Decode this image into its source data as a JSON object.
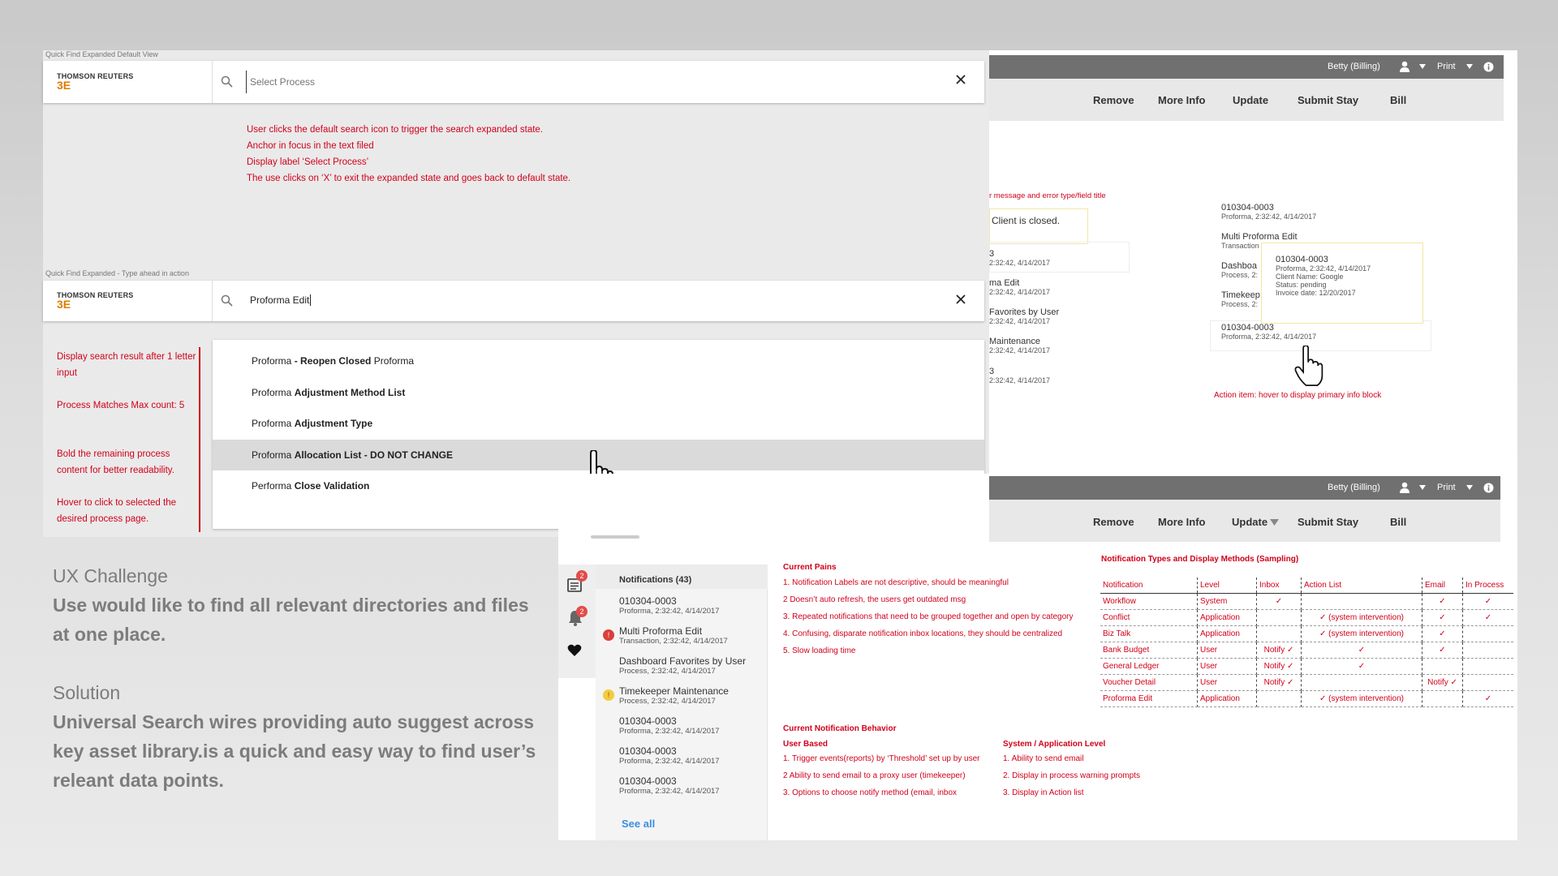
{
  "caption_default": "Quick Find Expanded Default View",
  "caption_typeahead": "Quick Find Expanded - Type ahead in action",
  "logo": {
    "top": "THOMSON REUTERS",
    "mark": "3E"
  },
  "default_search": {
    "placeholder": "Select Process",
    "notes": [
      "User clicks the default search icon to trigger the search expanded state.",
      "Anchor in focus in the text filed",
      "Display label ‘Select Process’",
      "The use clicks on ‘X’ to exit the expanded state and goes back to default state."
    ]
  },
  "typeahead_search": {
    "value": "Proforma Edit",
    "side_notes": [
      "Display search result after 1 letter input",
      "Process Matches Max count: 5",
      "Bold the  remaining process content for better readability.",
      "Hover to click to selected the desired process page."
    ],
    "results": [
      {
        "prefix": "Proforma",
        "bold": " - Reopen Closed",
        "suffix": " Proforma"
      },
      {
        "prefix": "Proforma ",
        "bold": "Adjustment Method List",
        "suffix": ""
      },
      {
        "prefix": "Proforma ",
        "bold": "Adjustment Type",
        "suffix": ""
      },
      {
        "prefix": "Proforma ",
        "bold": "Allocation List - DO NOT CHANGE",
        "suffix": ""
      },
      {
        "prefix": "Performa ",
        "bold": "Close Validation",
        "suffix": ""
      }
    ]
  },
  "topbar": {
    "user": "Betty (Billing)",
    "print": "Print"
  },
  "toolbar": {
    "remove": "Remove",
    "more_info": "More Info",
    "update": "Update",
    "submit_stay": "Submit Stay",
    "bill": "Bill"
  },
  "hover_panel": {
    "error_note": "r message and error type/field title",
    "client_closed": "Client is closed.",
    "left_items": [
      {
        "t": "3",
        "s": "2:32:42, 4/14/2017"
      },
      {
        "t": "ma Edit",
        "s": "2:32:42, 4/14/2017"
      },
      {
        "t": "Favorites by User",
        "s": "2:32:42, 4/14/2017"
      },
      {
        "t": "Maintenance",
        "s": "2:32:42, 4/14/2017"
      },
      {
        "t": "3",
        "s": "2:32:42, 4/14/2017"
      }
    ],
    "right_items": [
      {
        "t": "010304-0003",
        "s": "Proforma, 2:32:42, 4/14/2017"
      },
      {
        "t": "Multi Proforma Edit",
        "s": "Transaction"
      },
      {
        "t": "Dashboa",
        "s": "Process, 2:"
      },
      {
        "t": "Timekeep",
        "s": "Process, 2:"
      },
      {
        "t": "010304-0003",
        "s": "Proforma, 2:32:42, 4/14/2017"
      }
    ],
    "tooltip": {
      "title": "010304-0003",
      "lines": [
        "Proforma, 2:32:42, 4/14/2017",
        "Client Name: Google",
        "Status: pending",
        "Invoice date: 12/20/2017"
      ]
    },
    "action_note": "Action item: hover to display primary info block"
  },
  "notifications": {
    "header": "Notifications (43)",
    "badge_inbox": "2",
    "badge_bell": "2",
    "items": [
      {
        "t": "010304-0003",
        "s": "Proforma, 2:32:42, 4/14/2017",
        "mark": ""
      },
      {
        "t": "Multi Proforma Edit",
        "s": "Transaction, 2:32:42, 4/14/2017",
        "mark": "red"
      },
      {
        "t": "Dashboard Favorites by User",
        "s": "Process, 2:32:42, 4/14/2017",
        "mark": ""
      },
      {
        "t": "Timekeeper Maintenance",
        "s": "Process, 2:32:42, 4/14/2017",
        "mark": "yellow"
      },
      {
        "t": "010304-0003",
        "s": "Proforma, 2:32:42, 4/14/2017",
        "mark": ""
      },
      {
        "t": "010304-0003",
        "s": "Proforma, 2:32:42, 4/14/2017",
        "mark": ""
      },
      {
        "t": "010304-0003",
        "s": "Proforma, 2:32:42, 4/14/2017",
        "mark": ""
      }
    ],
    "see_all": "See all"
  },
  "current_pains": {
    "title": "Current Pains",
    "items": [
      "1. Notification Labels are not descriptive, should be meaningful",
      "2  Doesn’t auto refresh, the users get outdated msg",
      "3. Repeated notifications that need to be grouped together and open by category",
      "4. Confusing, disparate notification inbox locations, they should be centralized",
      "5. Slow loading time"
    ]
  },
  "current_behavior": {
    "title": "Current Notification Behavior",
    "user_based": {
      "title": "User Based",
      "items": [
        "1. Trigger events(reports) by ‘Threshold’ set up by user",
        "2  Ability to send email to a proxy user (timekeeper)",
        "3. Options to choose notify method (email, inbox"
      ]
    },
    "system_level": {
      "title": "System / Application Level",
      "items": [
        "1.  Ability to send email",
        "2.  Display in process warning prompts",
        "3.  Display in Action list"
      ]
    }
  },
  "notification_types": {
    "title": "Notification Types and Display Methods (Sampling)",
    "columns": [
      "Notification",
      "Level",
      "Inbox",
      "Action List",
      "Email",
      "In Process"
    ],
    "rows": [
      [
        "Workflow",
        "System",
        "✓",
        "",
        "✓",
        "✓"
      ],
      [
        "Conflict",
        "Application",
        "",
        "✓ (system intervention)",
        "✓",
        "✓"
      ],
      [
        "Biz Talk",
        "Application",
        "",
        "✓ (system intervention)",
        "✓",
        ""
      ],
      [
        "Bank Budget",
        "User",
        "Notify ✓",
        "✓",
        "✓",
        ""
      ],
      [
        "General Ledger",
        "User",
        "Notify ✓",
        "✓",
        "",
        ""
      ],
      [
        "Voucher Detail",
        "User",
        "Notify ✓",
        "",
        "Notify ✓",
        ""
      ],
      [
        "Proforma Edit",
        "Application",
        "",
        "✓ (system intervention)",
        "",
        "✓"
      ]
    ]
  },
  "ux": {
    "challenge_title": "UX Challenge",
    "challenge_text": "Use would like to find all relevant directories and files at one place.",
    "solution_title": "Solution",
    "solution_text": "Universal Search wires providing auto suggest across key asset library.is a quick and easy way to find user’s releant data points."
  }
}
